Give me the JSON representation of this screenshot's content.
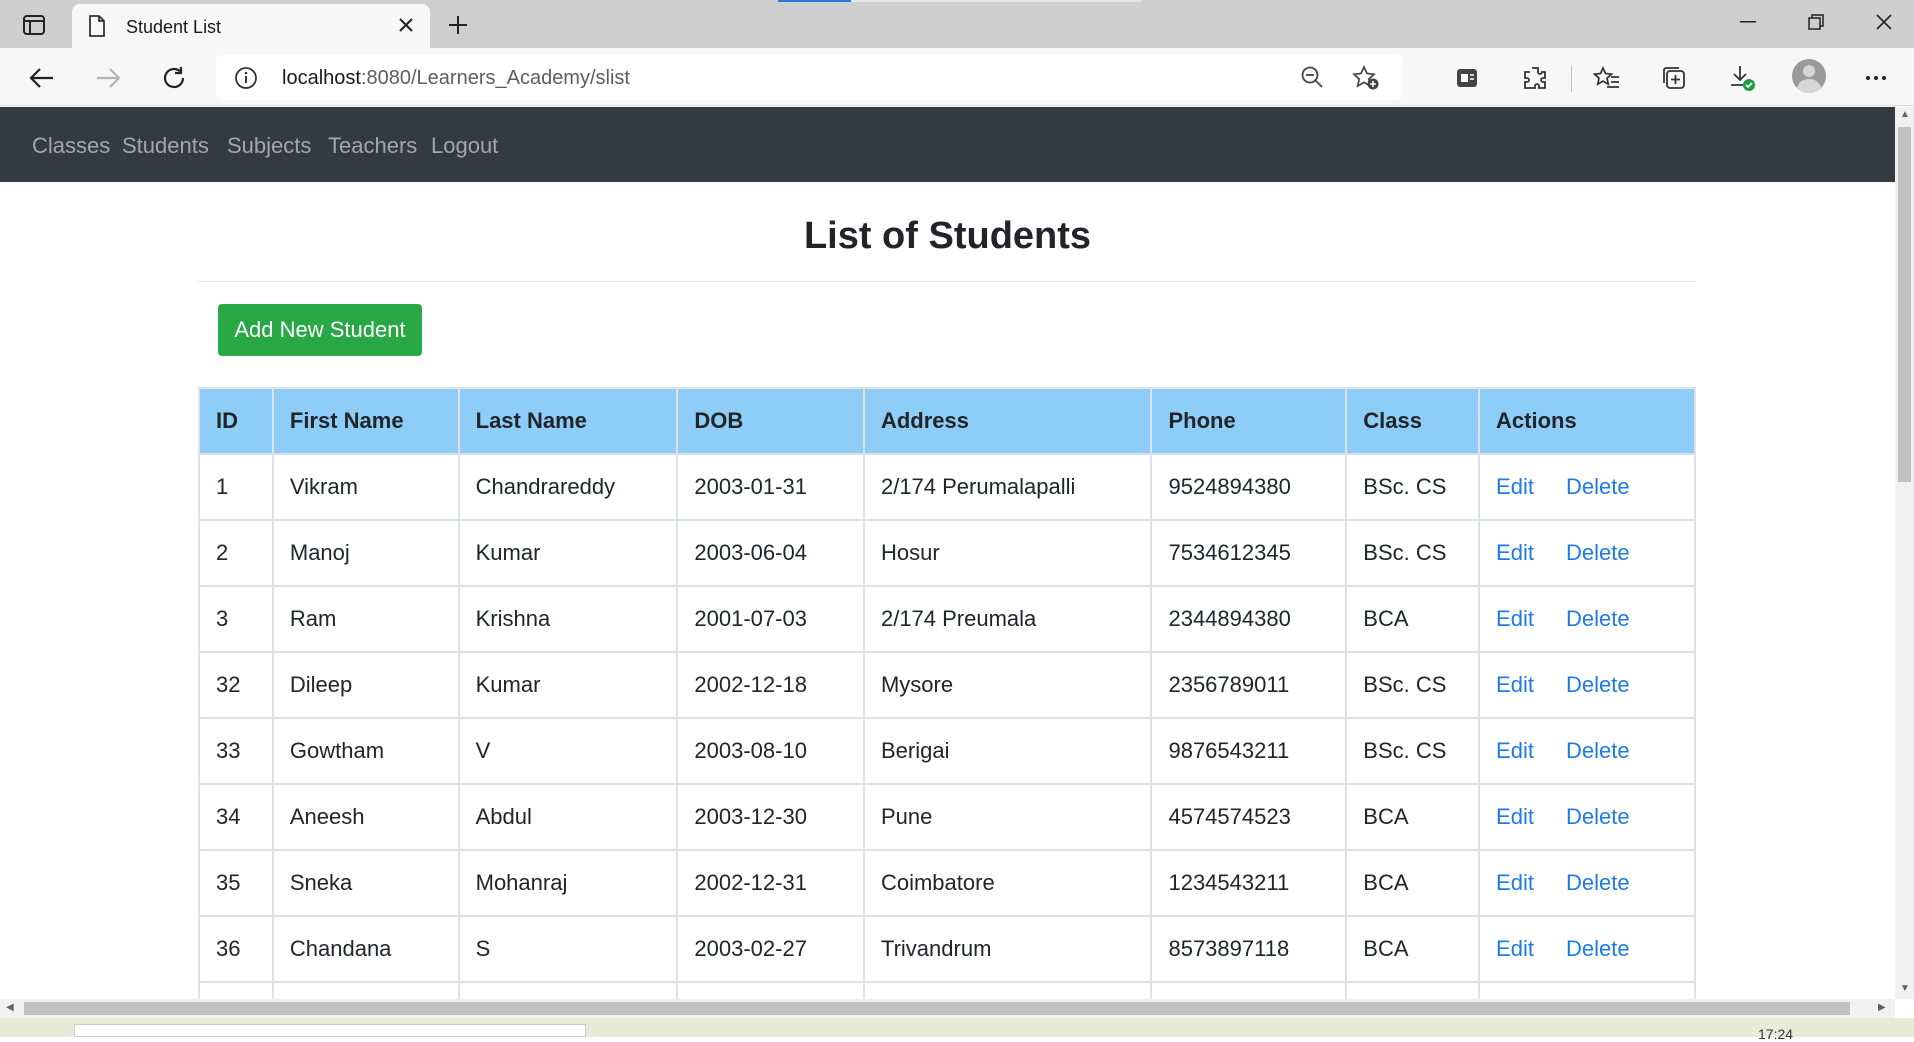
{
  "browser": {
    "tab_title": "Student List",
    "url_host": "localhost",
    "url_rest": ":8080/Learners_Academy/slist"
  },
  "nav": {
    "links": [
      "Classes",
      "Students",
      "Subjects",
      "Teachers",
      "Logout"
    ]
  },
  "page": {
    "title": "List of Students",
    "add_button": "Add New Student"
  },
  "table": {
    "headers": [
      "ID",
      "First Name",
      "Last Name",
      "DOB",
      "Address",
      "Phone",
      "Class",
      "Actions"
    ],
    "edit_label": "Edit",
    "delete_label": "Delete",
    "rows": [
      [
        "1",
        "Vikram",
        "Chandrareddy",
        "2003-01-31",
        "2/174 Perumalapalli",
        "9524894380",
        "BSc. CS"
      ],
      [
        "2",
        "Manoj",
        "Kumar",
        "2003-06-04",
        "Hosur",
        "7534612345",
        "BSc. CS"
      ],
      [
        "3",
        "Ram",
        "Krishna",
        "2001-07-03",
        "2/174 Preumala",
        "2344894380",
        "BCA"
      ],
      [
        "32",
        "Dileep",
        "Kumar",
        "2002-12-18",
        "Mysore",
        "2356789011",
        "BSc. CS"
      ],
      [
        "33",
        "Gowtham",
        "V",
        "2003-08-10",
        "Berigai",
        "9876543211",
        "BSc. CS"
      ],
      [
        "34",
        "Aneesh",
        "Abdul",
        "2003-12-30",
        "Pune",
        "4574574523",
        "BCA"
      ],
      [
        "35",
        "Sneka",
        "Mohanraj",
        "2002-12-31",
        "Coimbatore",
        "1234543211",
        "BCA"
      ],
      [
        "36",
        "Chandana",
        "S",
        "2003-02-27",
        "Trivandrum",
        "8573897118",
        "BCA"
      ]
    ]
  },
  "taskbar": {
    "clock": "17:24"
  },
  "colors": {
    "navbar": "#343a40",
    "header_bg": "#8ecdf8",
    "add_button": "#28a745",
    "link": "#1e7be6"
  }
}
